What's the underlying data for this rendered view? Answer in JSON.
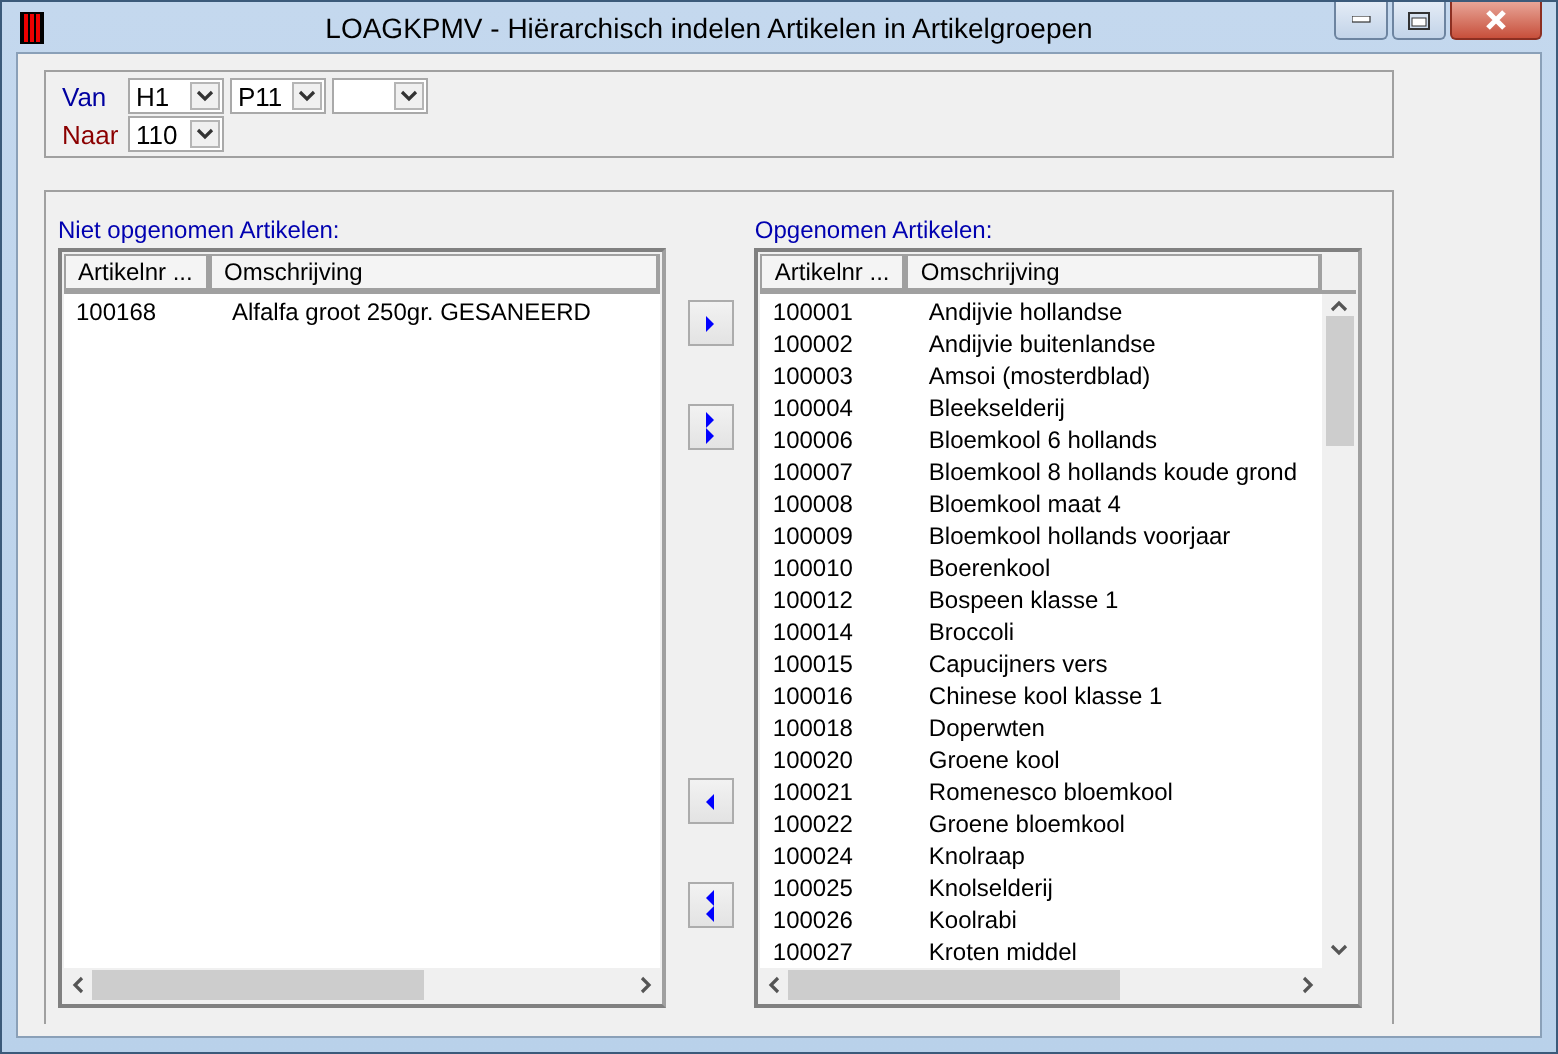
{
  "window": {
    "title": "LOAGKPMV - Hiërarchisch indelen Artikelen in Artikelgroepen"
  },
  "filters": [
    {
      "label": "Van",
      "kind": "from",
      "combos": [
        {
          "kind": "filled",
          "value": "H1"
        },
        {
          "kind": "filled",
          "value": "P11"
        },
        {
          "kind": "blank"
        }
      ]
    },
    {
      "label": "Naar",
      "kind": "to",
      "combos": [
        {
          "kind": "filled",
          "value": "110"
        }
      ]
    }
  ],
  "left_list": {
    "caption": "Niet opgenomen Artikelen:",
    "columns": [
      "Artikelnr ...",
      "Omschrijving"
    ],
    "rows": [
      [
        "100168",
        "Alfalfa groot 250gr. GESANEERD"
      ]
    ]
  },
  "right_list": {
    "caption": "Opgenomen Artikelen:",
    "columns": [
      "Artikelnr ...",
      "Omschrijving"
    ],
    "rows": [
      [
        "100001",
        "Andijvie hollandse"
      ],
      [
        "100002",
        "Andijvie buitenlandse"
      ],
      [
        "100003",
        "Amsoi (mosterdblad)"
      ],
      [
        "100004",
        "Bleekselderij"
      ],
      [
        "100006",
        "Bloemkool 6 hollands"
      ],
      [
        "100007",
        "Bloemkool 8 hollands koude grond"
      ],
      [
        "100008",
        "Bloemkool maat 4"
      ],
      [
        "100009",
        "Bloemkool hollands voorjaar"
      ],
      [
        "100010",
        "Boerenkool"
      ],
      [
        "100012",
        "Bospeen klasse 1"
      ],
      [
        "100014",
        "Broccoli"
      ],
      [
        "100015",
        "Capucijners vers"
      ],
      [
        "100016",
        "Chinese kool klasse 1"
      ],
      [
        "100018",
        "Doperwten"
      ],
      [
        "100020",
        "Groene kool"
      ],
      [
        "100021",
        "Romenesco bloemkool"
      ],
      [
        "100022",
        "Groene bloemkool"
      ],
      [
        "100024",
        "Knolraap"
      ],
      [
        "100025",
        "Knolselderij"
      ],
      [
        "100026",
        "Koolrabi"
      ],
      [
        "100027",
        "Kroten middel"
      ]
    ]
  },
  "move_buttons": [
    {
      "kind": "add"
    },
    {
      "kind": "add_all"
    },
    {
      "kind": "remove"
    },
    {
      "kind": "remove_all"
    }
  ]
}
